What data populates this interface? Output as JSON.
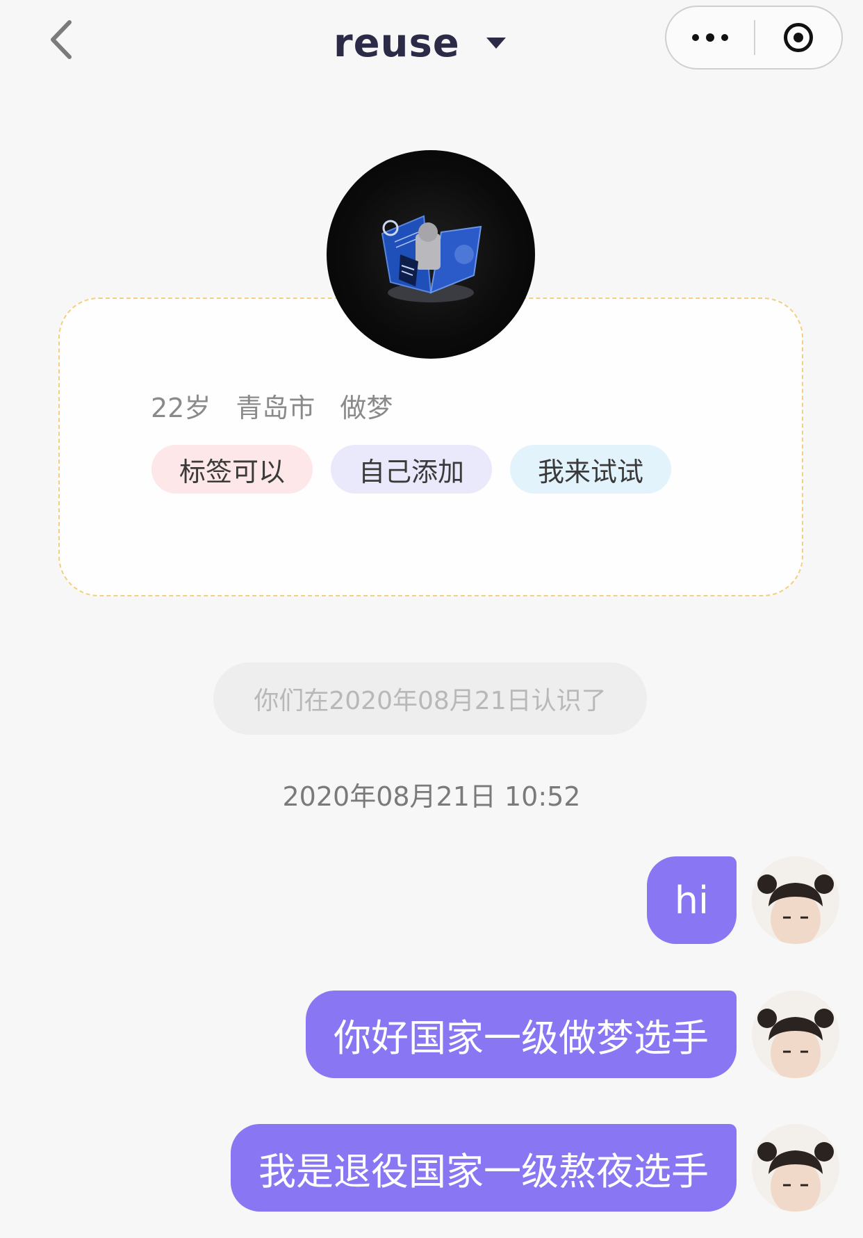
{
  "header": {
    "back_icon": "chevron-left-icon",
    "title": "reuse",
    "title_caret_icon": "caret-down-icon",
    "more_icon": "more-dots-icon",
    "close_icon": "target-circle-icon"
  },
  "profile": {
    "avatar_icon": "profile-avatar-image",
    "age": "22岁",
    "city": "青岛市",
    "occupation": "做梦",
    "tags": [
      "标签可以",
      "自己添加",
      "我来试试"
    ]
  },
  "notices": {
    "met_since": "你们在2020年08月21日认识了",
    "timestamp": "2020年08月21日 10:52"
  },
  "messages": [
    {
      "text": "hi",
      "sender": "self"
    },
    {
      "text": "你好国家一级做梦选手",
      "sender": "self"
    },
    {
      "text": "我是退役国家一级熬夜选手",
      "sender": "self"
    }
  ],
  "colors": {
    "accent_purple": "#8876f2",
    "title_navy": "#2b2b48",
    "card_border": "#f3cf82",
    "tag_pink": "#fde7e8",
    "tag_lavender": "#e9e9fb",
    "tag_sky": "#e3f3fc"
  }
}
